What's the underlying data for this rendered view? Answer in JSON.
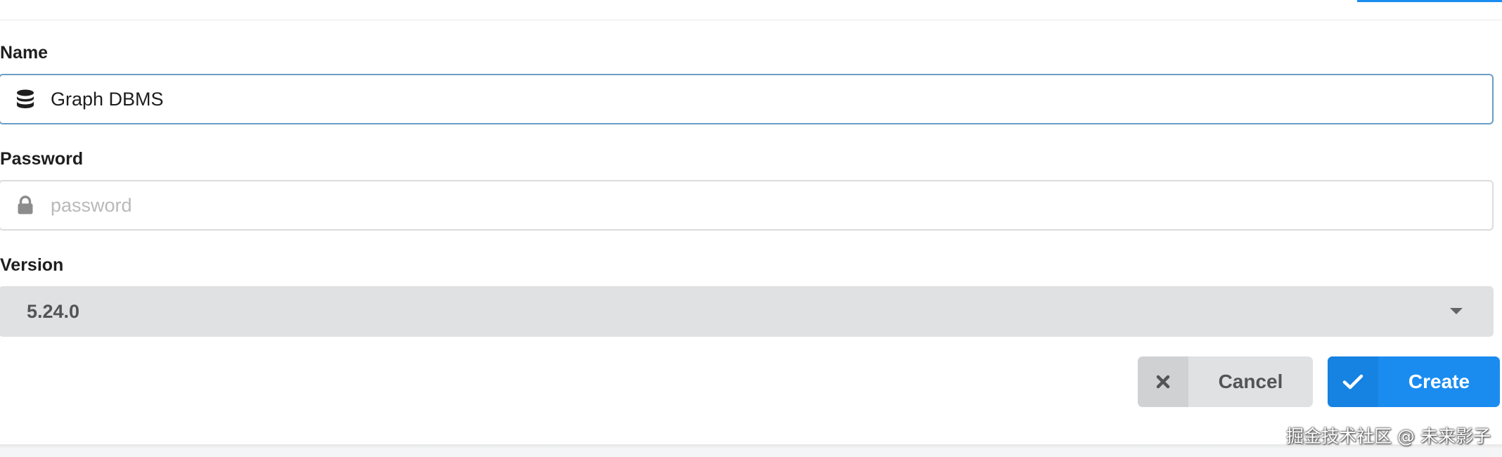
{
  "form": {
    "name_field": {
      "label": "Name",
      "value": "Graph DBMS",
      "icon": "database-icon"
    },
    "password_field": {
      "label": "Password",
      "value": "",
      "placeholder": "password",
      "icon": "lock-icon"
    },
    "version_field": {
      "label": "Version",
      "selected": "5.24.0",
      "icon": "caret-down-icon"
    }
  },
  "actions": {
    "cancel_label": "Cancel",
    "cancel_icon": "close-icon",
    "create_label": "Create",
    "create_icon": "check-icon"
  },
  "watermark": "掘金技术社区 @ 未来影子",
  "colors": {
    "primary": "#1a8cf0",
    "secondary": "#e0e1e2",
    "focus_border": "#6a9ec6"
  }
}
